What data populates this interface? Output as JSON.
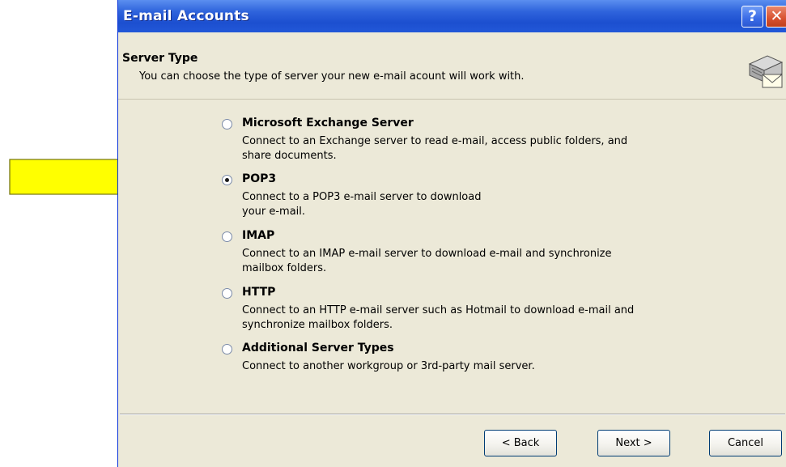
{
  "window": {
    "title": "E-mail Accounts",
    "help_glyph": "?",
    "close_glyph": "✕"
  },
  "header": {
    "title": "Server Type",
    "description": "You can choose the type of server your new e-mail acount will work with.",
    "icon": "mail-server-icon"
  },
  "options": [
    {
      "label": "Microsoft Exchange Server",
      "description": "Connect to an Exchange server to read e-mail, access public folders, and\nshare documents.",
      "selected": false
    },
    {
      "label": "POP3",
      "description": "Connect to a POP3 e-mail server to download\nyour e-mail.",
      "selected": true
    },
    {
      "label": "IMAP",
      "description": "Connect to an IMAP e-mail server to download e-mail and synchronize\nmailbox folders.",
      "selected": false
    },
    {
      "label": "HTTP",
      "description": "Connect to an HTTP e-mail server such as Hotmail to download e-mail and\nsynchronize mailbox folders.",
      "selected": false
    },
    {
      "label": "Additional Server Types",
      "description": "Connect to another workgroup or 3rd-party mail server.",
      "selected": false
    }
  ],
  "buttons": {
    "back": "< Back",
    "next": "Next >",
    "cancel": "Cancel"
  },
  "annotation": {
    "icon": "arrow-right-icon",
    "color": "#ffff00"
  }
}
